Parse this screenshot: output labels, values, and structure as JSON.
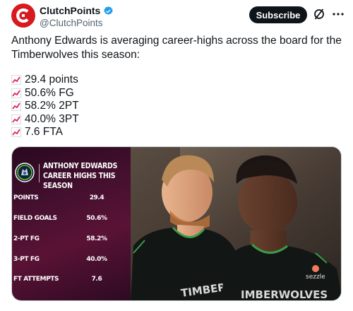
{
  "account": {
    "display_name": "ClutchPoints",
    "handle": "@ClutchPoints",
    "verified": true,
    "avatar_icon": "clutchpoints-logo",
    "brand_color": "#d71920"
  },
  "actions": {
    "subscribe_label": "Subscribe",
    "grok_icon": "grok-icon",
    "more_icon": "more-options-icon"
  },
  "tweet": {
    "text": "Anthony Edwards is averaging career-highs across the board for the Timberwolves this season:",
    "stats": [
      {
        "icon": "chart-increasing-emoji",
        "text": "29.4 points"
      },
      {
        "icon": "chart-increasing-emoji",
        "text": "50.6% FG"
      },
      {
        "icon": "chart-increasing-emoji",
        "text": "58.2% 2PT"
      },
      {
        "icon": "chart-increasing-emoji",
        "text": "40.0% 3PT"
      },
      {
        "icon": "chart-increasing-emoji",
        "text": "7.6 FTA"
      }
    ]
  },
  "media": {
    "graphic": {
      "title_line1": "ANTHONY EDWARDS",
      "title_line2": "CAREER HIGHS THIS SEASON",
      "rows": [
        {
          "label": "POINTS",
          "value": "29.4"
        },
        {
          "label": "FIELD GOALS",
          "value": "50.6%"
        },
        {
          "label": "2-PT FG",
          "value": "58.2%"
        },
        {
          "label": "3-PT FG",
          "value": "40.0%"
        },
        {
          "label": "FT ATTEMPTS",
          "value": "7.6"
        }
      ]
    },
    "photo": {
      "jersey_text_left": "TIMBERWO",
      "jersey_text_right": "IMBERWOLVES",
      "sponsor_text": "sezzle"
    }
  }
}
